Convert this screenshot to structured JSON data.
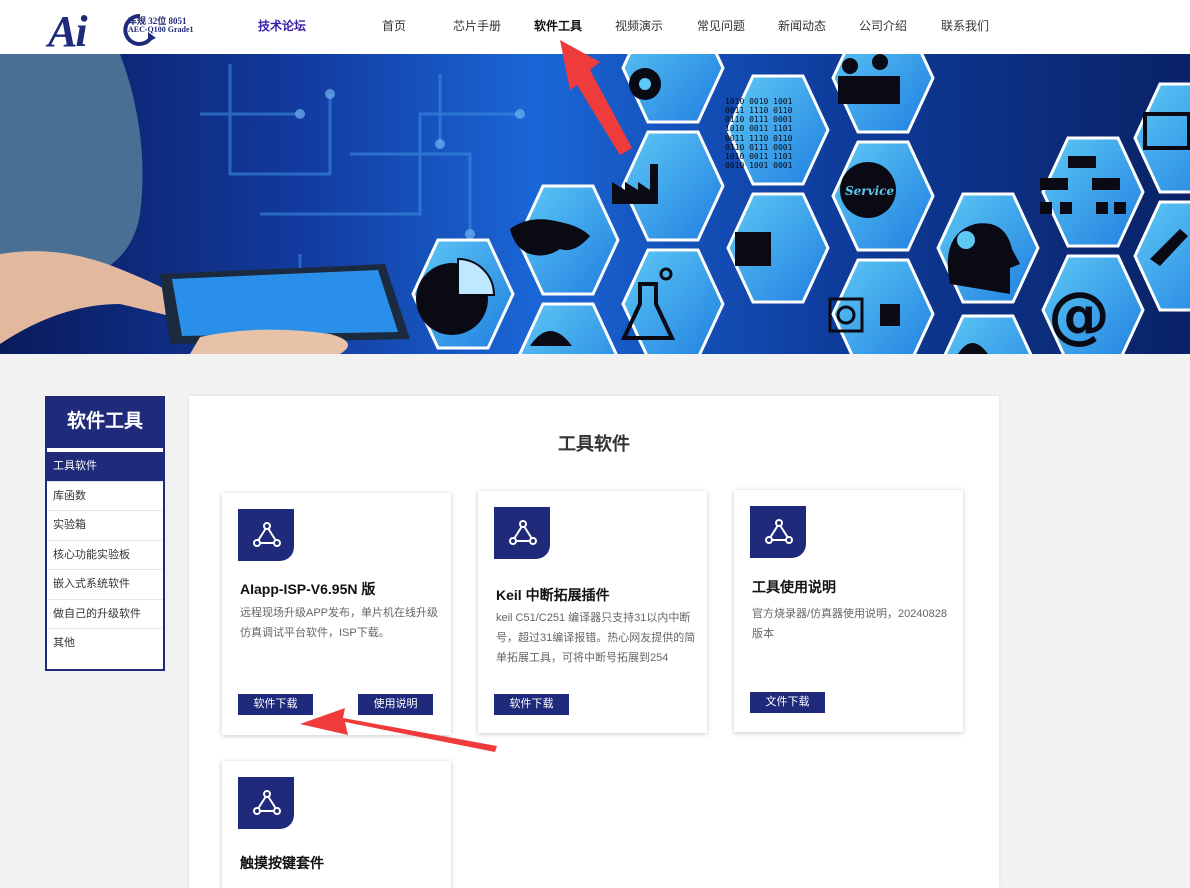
{
  "logo": {
    "mark": "Ai",
    "line1": "车规 32位 8051",
    "line2": "AEC-Q100 Grade1"
  },
  "header": {
    "forum": "技术论坛",
    "nav": [
      "首页",
      "芯片手册",
      "软件工具",
      "视频演示",
      "常见问题",
      "新闻动态",
      "公司介绍",
      "联系我们"
    ],
    "active_nav": "软件工具"
  },
  "banner": {
    "binary_lines": [
      "1010  0010  1001",
      "0011  1110  0110",
      "0110  0111  0001",
      "1010  0011  1101",
      "0011  1110  0110",
      "0110  0111  0001",
      "1010  0011  1101",
      "0010  1001  0001"
    ],
    "service_label": "Service",
    "at_symbol": "@"
  },
  "sidebar": {
    "title": "软件工具",
    "items": [
      "工具软件",
      "库函数",
      "实验箱",
      "核心功能实验板",
      "嵌入式系统软件",
      "做自己的升级软件",
      "其他"
    ]
  },
  "main": {
    "title": "工具软件",
    "cards": [
      {
        "title": "AIapp-ISP-V6.95N 版",
        "desc": "远程现场升级APP发布，单片机在线升级仿真调试平台软件，ISP下载。",
        "buttons": [
          "软件下载",
          "使用说明"
        ]
      },
      {
        "title": "Keil 中断拓展插件",
        "desc": "keil C51/C251 编译器只支持31以内中断号，超过31编译报错。热心网友提供的简单拓展工具，可将中断号拓展到254",
        "buttons": [
          "软件下载"
        ]
      },
      {
        "title": "工具使用说明",
        "desc": "官方烧录器/仿真器使用说明，20240828版本",
        "buttons": [
          "文件下载"
        ]
      },
      {
        "title": "触摸按键套件",
        "desc": "",
        "buttons": []
      }
    ]
  },
  "colors": {
    "brand": "#1f2a7a",
    "annotation_arrow": "#ef3b3b"
  },
  "icons": {
    "card_icon": "share-nodes-icon"
  }
}
